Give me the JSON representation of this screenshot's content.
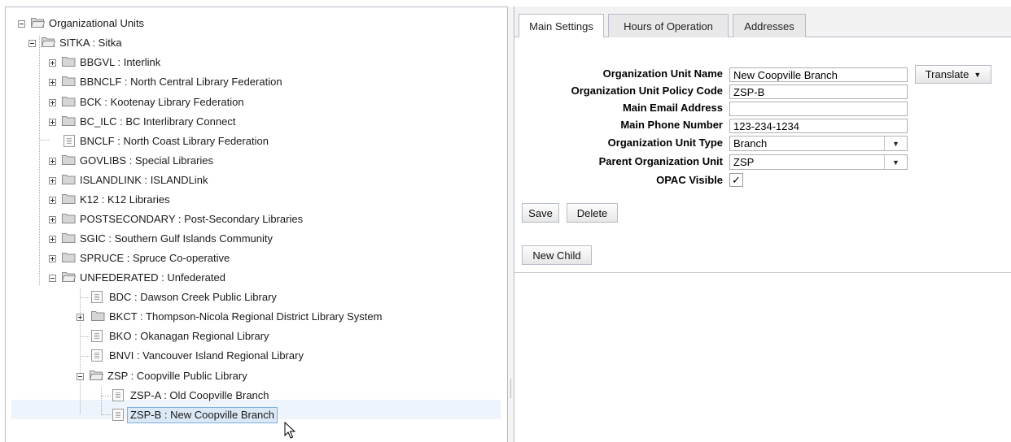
{
  "tree": {
    "nodes": [
      {
        "label": "Organizational Units"
      },
      {
        "label": "SITKA : Sitka"
      },
      {
        "label": "BBGVL : Interlink"
      },
      {
        "label": "BBNCLF : North Central Library Federation"
      },
      {
        "label": "BCK : Kootenay Library Federation"
      },
      {
        "label": "BC_ILC : BC Interlibrary Connect"
      },
      {
        "label": "BNCLF : North Coast Library Federation"
      },
      {
        "label": "GOVLIBS : Special Libraries"
      },
      {
        "label": "ISLANDLINK : ISLANDLink"
      },
      {
        "label": "K12 : K12 Libraries"
      },
      {
        "label": "POSTSECONDARY : Post-Secondary Libraries"
      },
      {
        "label": "SGIC : Southern Gulf Islands Community"
      },
      {
        "label": "SPRUCE : Spruce Co-operative"
      },
      {
        "label": "UNFEDERATED : Unfederated"
      },
      {
        "label": "BDC : Dawson Creek Public Library"
      },
      {
        "label": "BKCT : Thompson-Nicola Regional District Library System"
      },
      {
        "label": "BKO : Okanagan Regional Library"
      },
      {
        "label": "BNVI : Vancouver Island Regional Library"
      },
      {
        "label": "ZSP : Coopville Public Library"
      },
      {
        "label": "ZSP-A : Old Coopville Branch"
      },
      {
        "label": "ZSP-B : New Coopville Branch"
      }
    ]
  },
  "tabs": [
    {
      "label": "Main Settings"
    },
    {
      "label": "Hours of Operation"
    },
    {
      "label": "Addresses"
    }
  ],
  "form": {
    "name_label": "Organization Unit Name",
    "name_value": "New Coopville Branch",
    "translate_label": "Translate",
    "policy_label": "Organization Unit Policy Code",
    "policy_value": "ZSP-B",
    "email_label": "Main Email Address",
    "email_value": "",
    "phone_label": "Main Phone Number",
    "phone_value": "123-234-1234",
    "type_label": "Organization Unit Type",
    "type_value": "Branch",
    "parent_label": "Parent Organization Unit",
    "parent_value": "ZSP",
    "opac_label": "OPAC Visible",
    "opac_checked": "✓"
  },
  "buttons": {
    "save": "Save",
    "delete": "Delete",
    "new_child": "New Child"
  },
  "colors": {
    "selection_bg": "#dbe8f5",
    "selection_border": "#7eaee6",
    "border": "#b5bcc7"
  }
}
